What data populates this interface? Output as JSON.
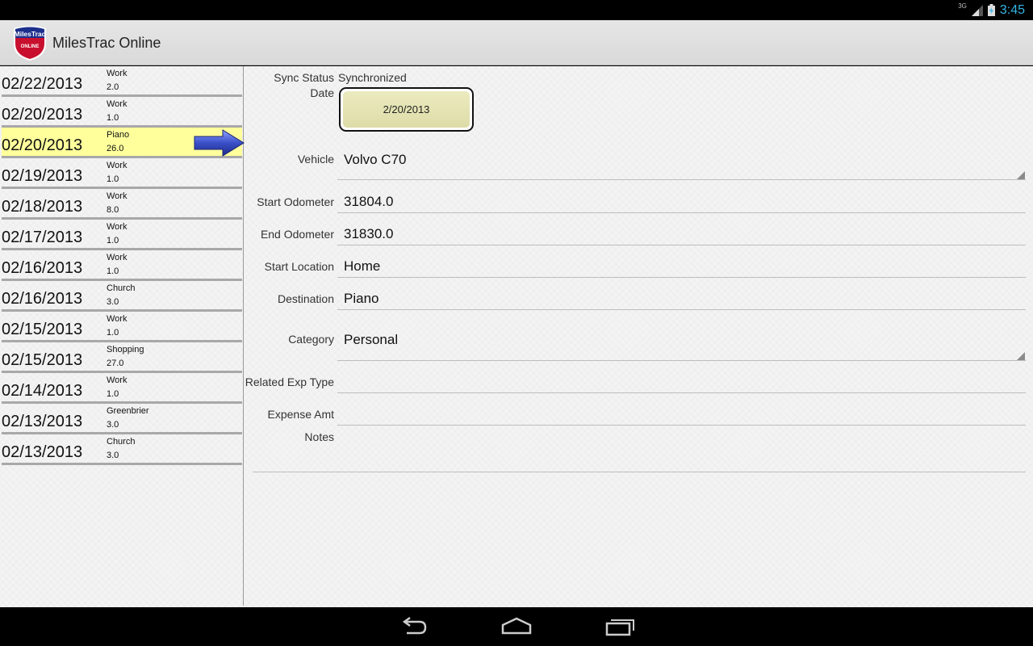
{
  "status_bar": {
    "network": "3G",
    "time": "3:45"
  },
  "app": {
    "title": "MilesTrac Online",
    "logo_text_top": "MilesTrac",
    "logo_text_bottom": "ONLINE"
  },
  "trips": [
    {
      "date": "02/22/2013",
      "category": "Work",
      "miles": "2.0"
    },
    {
      "date": "02/20/2013",
      "category": "Work",
      "miles": "1.0"
    },
    {
      "date": "02/20/2013",
      "category": "Piano",
      "miles": "26.0",
      "selected": true
    },
    {
      "date": "02/19/2013",
      "category": "Work",
      "miles": "1.0"
    },
    {
      "date": "02/18/2013",
      "category": "Work",
      "miles": "8.0"
    },
    {
      "date": "02/17/2013",
      "category": "Work",
      "miles": "1.0"
    },
    {
      "date": "02/16/2013",
      "category": "Work",
      "miles": "1.0"
    },
    {
      "date": "02/16/2013",
      "category": "Church",
      "miles": "3.0"
    },
    {
      "date": "02/15/2013",
      "category": "Work",
      "miles": "1.0"
    },
    {
      "date": "02/15/2013",
      "category": "Shopping",
      "miles": "27.0"
    },
    {
      "date": "02/14/2013",
      "category": "Work",
      "miles": "1.0"
    },
    {
      "date": "02/13/2013",
      "category": "Greenbrier",
      "miles": "3.0"
    },
    {
      "date": "02/13/2013",
      "category": "Church",
      "miles": "3.0"
    }
  ],
  "detail": {
    "sync_status_label": "Sync Status",
    "sync_status_value": "Synchronized",
    "date_label": "Date",
    "date_value": "2/20/2013",
    "vehicle_label": "Vehicle",
    "vehicle_value": "Volvo C70",
    "start_odometer_label": "Start Odometer",
    "start_odometer_value": "31804.0",
    "end_odometer_label": "End Odometer",
    "end_odometer_value": "31830.0",
    "start_location_label": "Start Location",
    "start_location_value": "Home",
    "destination_label": "Destination",
    "destination_value": "Piano",
    "category_label": "Category",
    "category_value": "Personal",
    "related_exp_type_label": "Related Exp Type",
    "related_exp_type_value": "",
    "expense_amt_label": "Expense Amt",
    "expense_amt_value": "",
    "notes_label": "Notes",
    "notes_value": ""
  },
  "colors": {
    "selected_row": "#ffff9c",
    "clock": "#33b5e5",
    "date_button": "#e4e3b3",
    "arrow": "#3a4fc8"
  },
  "icons": {
    "back": "back-icon",
    "home": "home-icon",
    "recents": "recents-icon"
  }
}
